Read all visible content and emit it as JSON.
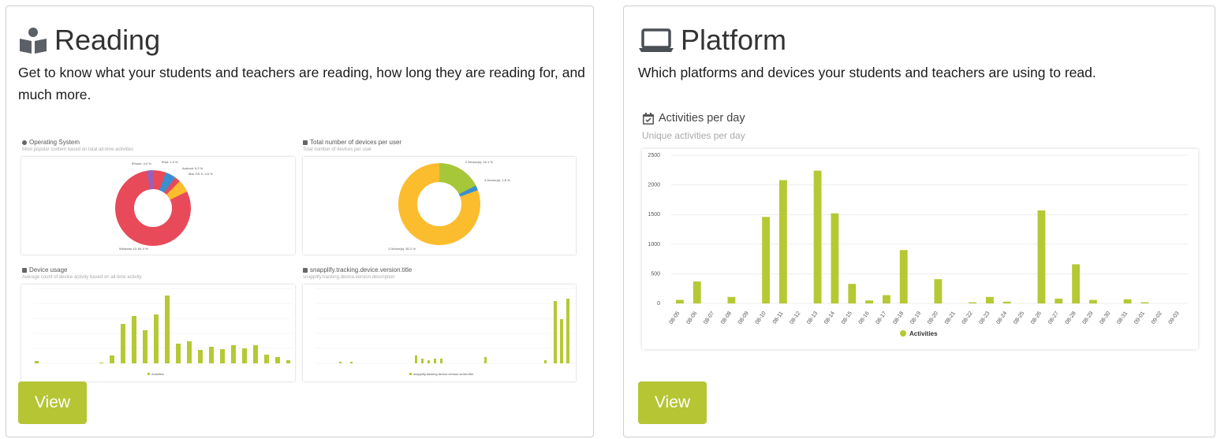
{
  "colors": {
    "accent": "#b5c534",
    "bar": "#b5c934",
    "donut_red": "#e84a5a",
    "donut_yellow": "#fbbd2e",
    "donut_blue": "#3a8fd1"
  },
  "reading": {
    "title": "Reading",
    "icon": "book-reader-icon",
    "description": "Get to know what your students and teachers are reading, how long they are reading for, and much more.",
    "view_label": "View",
    "preview": {
      "os": {
        "title": "Operating System",
        "subtitle": "Most popular content based on total all-time activities"
      },
      "devices": {
        "title": "Total number of devices per user",
        "subtitle": "Total number of devices per user"
      },
      "usage": {
        "title": "Device usage",
        "subtitle": "Average count of device activity based on all-time activity"
      },
      "version": {
        "title": "snapplify.tracking.device.version.title",
        "subtitle": "snapplify.tracking.device.version.description"
      }
    }
  },
  "platform": {
    "title": "Platform",
    "icon": "laptop-icon",
    "description": "Which platforms and devices your students and teachers are using to read.",
    "view_label": "View",
    "chart_title": "Activities per day",
    "chart_subtitle": "Unique activities per day",
    "chart_data": {
      "type": "bar",
      "categories": [
        "08-05",
        "08-06",
        "08-07",
        "08-08",
        "08-09",
        "08-10",
        "08-11",
        "08-12",
        "08-13",
        "08-14",
        "08-15",
        "08-16",
        "08-17",
        "08-18",
        "08-19",
        "08-20",
        "08-21",
        "08-22",
        "08-23",
        "08-24",
        "08-25",
        "08-26",
        "08-27",
        "08-28",
        "08-29",
        "08-30",
        "08-31",
        "09-01",
        "09-02",
        "09-03"
      ],
      "series": [
        {
          "name": "Activities",
          "values": [
            60,
            370,
            0,
            110,
            0,
            1460,
            2080,
            0,
            2240,
            1520,
            330,
            50,
            140,
            900,
            0,
            410,
            0,
            20,
            110,
            30,
            0,
            1570,
            80,
            660,
            60,
            0,
            70,
            20,
            0,
            0
          ]
        }
      ],
      "ylim": [
        0,
        2500
      ],
      "yticks": [
        0,
        500,
        1000,
        1500,
        2000,
        2500
      ],
      "grid": true,
      "legend": "bottom"
    }
  }
}
